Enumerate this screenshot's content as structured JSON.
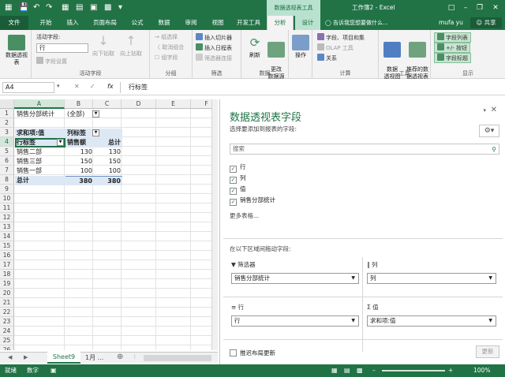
{
  "titlebar": {
    "context_tools": "数据透视表工具",
    "doc_title": "工作簿2 - Excel",
    "restore_icon": "❐"
  },
  "tabs": {
    "file": "文件",
    "items": [
      "开始",
      "插入",
      "页面布局",
      "公式",
      "数据",
      "审阅",
      "视图",
      "开发工具",
      "分析",
      "设计"
    ],
    "active": "分析",
    "tell_me": "告诉我您想要做什么...",
    "user": "mufa yu",
    "share": "共享"
  },
  "ribbon": {
    "pivot_table": "数据透视表",
    "active_field_label": "活动字段:",
    "active_field_value": "行",
    "field_settings": "字段设置",
    "drill_down": "向下钻取",
    "drill_up": "向上钻取",
    "active_field_group": "活动字段",
    "group_selection": "组选择",
    "ungroup": "取消组合",
    "group_field": "组字段",
    "group_group": "分组",
    "insert_slicer": "插入切片器",
    "insert_timeline": "插入日程表",
    "filter_connections": "筛选器连接",
    "filter_group": "筛选",
    "refresh": "刷新",
    "change_source": "更改\n数据源",
    "data_group": "数据",
    "actions": "操作",
    "fields_items_sets": "字段、项目和集",
    "olap_tools": "OLAP 工具",
    "relationships": "关系",
    "calc_group": "计算",
    "pivot_chart": "数据\n透视图",
    "recommended_pivot": "推荐的数\n据透视表",
    "tools_group": "工具",
    "field_list": "字段列表",
    "buttons": "+/- 按钮",
    "field_headers": "字段标题",
    "show_group": "显示"
  },
  "formula_bar": {
    "name_box": "A4",
    "fx": "fx",
    "content": "行标签"
  },
  "grid": {
    "columns": [
      "A",
      "B",
      "C",
      "D",
      "E",
      "F"
    ],
    "rows": [
      "1",
      "2",
      "3",
      "4",
      "5",
      "6",
      "7",
      "8",
      "9",
      "10",
      "11",
      "12",
      "13",
      "14",
      "15",
      "16",
      "17",
      "18",
      "19",
      "20",
      "21",
      "22",
      "23",
      "24",
      "25",
      "26"
    ],
    "a1": "销售分部统计",
    "b1": "(全部)",
    "a3": "求和项:值",
    "b3": "列标签",
    "a4": "行标签",
    "b4": "销售额",
    "c4": "总计",
    "body_rows": [
      {
        "label": "销售二部",
        "value": "130",
        "total": "130"
      },
      {
        "label": "销售三部",
        "value": "150",
        "total": "150"
      },
      {
        "label": "销售一部",
        "value": "100",
        "total": "100"
      }
    ],
    "total_label": "总计",
    "total_value": "380",
    "total_total": "380"
  },
  "sheets": {
    "active": "Sheet9",
    "next": "1月"
  },
  "status": {
    "ready": "就绪",
    "mode": "数字",
    "zoom": "100%"
  },
  "pane": {
    "title": "数据透视表字段",
    "subtitle": "选择要添加到报表的字段:",
    "search_placeholder": "搜索",
    "fields": [
      "行",
      "列",
      "值",
      "销售分部统计"
    ],
    "more_tables": "更多表格...",
    "drag_hint": "在以下区域间拖动字段:",
    "filters_label": "筛选器",
    "columns_label": "列",
    "rows_label": "行",
    "values_label": "值",
    "filters_value": "销售分部统计",
    "columns_value": "列",
    "rows_value": "行",
    "values_value": "求和项:值",
    "defer_update": "推迟布局更新",
    "update_btn": "更新"
  },
  "colors": {
    "accent": "#217346",
    "context_tab": "#b8e2cf",
    "pivot_band": "#dde8f5"
  }
}
